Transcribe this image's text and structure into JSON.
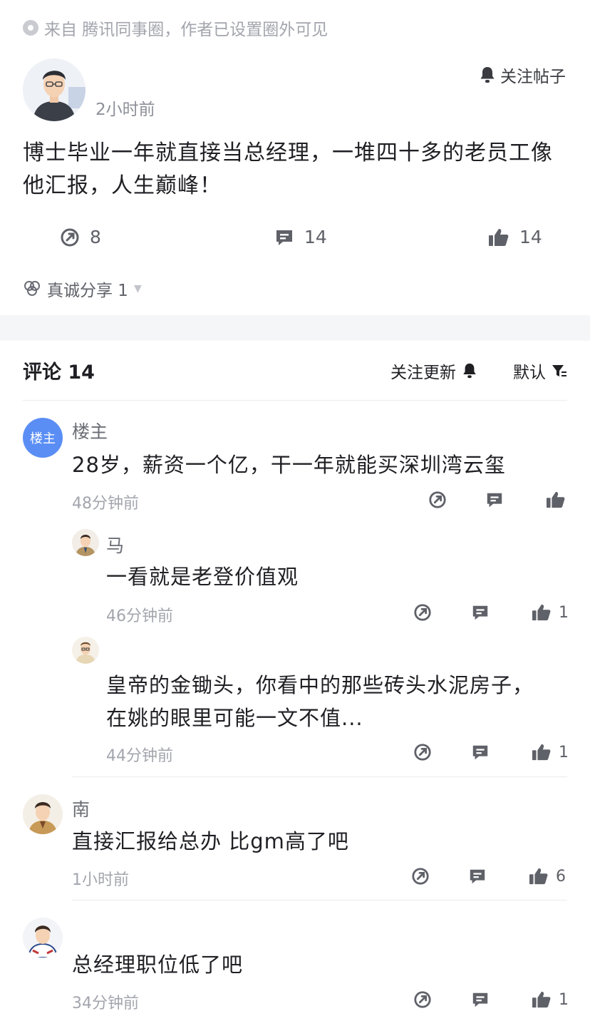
{
  "source": {
    "text": "来自 腾讯同事圈，作者已设置圈外可见"
  },
  "post": {
    "time": "2小时前",
    "follow_label": "关注帖子",
    "text": "博士毕业一年就直接当总经理，一堆四十多的老员工像他汇报，人生巅峰！",
    "stats": {
      "forward": "8",
      "comments": "14",
      "likes": "14"
    },
    "share_label": "真诚分享 1"
  },
  "comments_header": {
    "title": "评论 14",
    "follow_update": "关注更新",
    "sort": "默认"
  },
  "comments": [
    {
      "badge": "楼主",
      "name": "楼主",
      "text": "28岁，薪资一个亿，干一年就能买深圳湾云玺",
      "time": "48分钟前",
      "likes": ""
    },
    {
      "name": "马",
      "text": "一看就是老登价值观",
      "time": "46分钟前",
      "likes": "1"
    },
    {
      "name": "",
      "text": "皇帝的金锄头，你看中的那些砖头水泥房子，在姚的眼里可能一文不值...",
      "time": "44分钟前",
      "likes": "1"
    },
    {
      "name": "南",
      "text": "直接汇报给总办 比gm高了吧",
      "time": "1小时前",
      "likes": "6"
    },
    {
      "name": "",
      "text": "总经理职位低了吧",
      "time": "34分钟前",
      "likes": "1"
    }
  ],
  "colors": {
    "accent_blue": "#5b8ef5",
    "text_primary": "#1f1f24",
    "text_secondary": "#8e9099"
  }
}
